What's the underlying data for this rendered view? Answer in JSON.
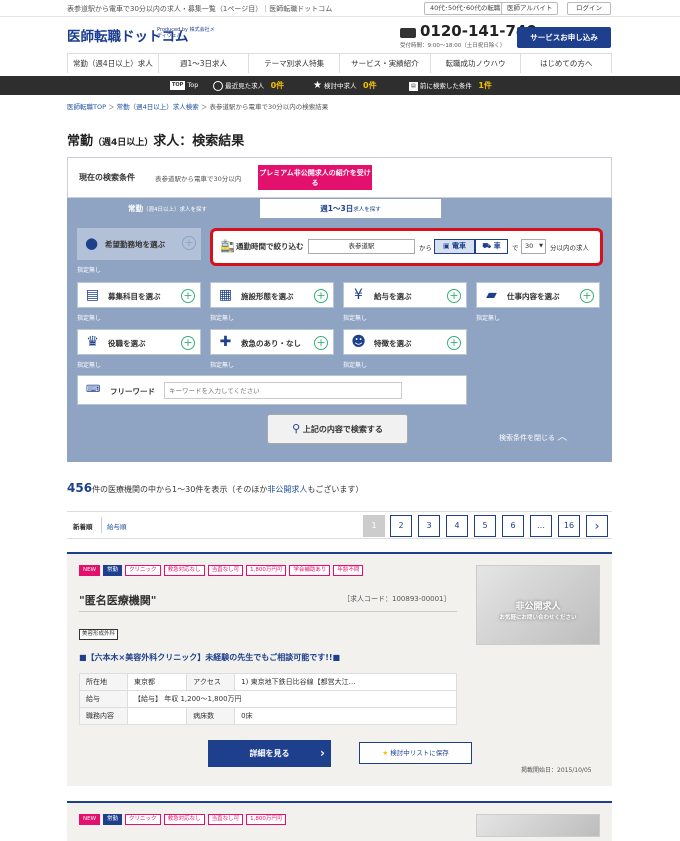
{
  "topbar": {
    "breadcrumb": "表参道駅から電車で30分以内の求人・募集一覧（1ページ目）｜医師転職ドットコム",
    "btn_age": "40代･50代･60代の転職",
    "btn_part": "医師アルバイト",
    "btn_login": "ログイン"
  },
  "header": {
    "logo": "医師転職ドットコム",
    "logo_sub": "Produced by 株式会社メディウェル",
    "phone": "0120-141-740",
    "hours": "受付時間：9:00～18:00（土日祝日除く）",
    "apply": "サービスお申し込み"
  },
  "nav": [
    "常勤（週4日以上）求人",
    "週1～3日求人",
    "テーマ別求人特集",
    "サービス・実績紹介",
    "転職成功ノウハウ",
    "はじめての方へ"
  ],
  "history": {
    "top": "Top",
    "recent_label": "最近見た求人",
    "recent_count": "0件",
    "watch_label": "検討中求人",
    "watch_count": "0件",
    "prev_label": "前に検索した条件",
    "prev_count": "1件"
  },
  "breadcrumb": {
    "home": "医師転職TOP",
    "sep1": "＞",
    "list": "常勤（週4日以上）求人検索",
    "sep2": "＞",
    "current": "表参道駅から電車で30分以内の検索結果"
  },
  "page_title": "常勤",
  "page_title_sub": "（週4日以上）",
  "page_title_rest": "求人：検索結果",
  "conditions": {
    "label": "現在の検索条件",
    "value": "表参道駅から電車で30分以内",
    "premium": "プレミアム非公開求人の紹介を受ける",
    "tab_full": "常勤",
    "tab_full_sub": "（週4日以上）",
    "tab_full_tail": "求人を探す",
    "tab_part": "週1～3日",
    "tab_part_tail": "求人を探す"
  },
  "filters": {
    "area": "希望勤務地を選ぶ",
    "commute_label": "通勤時間で絞り込む",
    "station": "表参道駅",
    "kara": "から",
    "train": "電車",
    "car": "車",
    "de": "で",
    "minutes": "30",
    "minutes_tail": "分以内の求人",
    "specialty": "募集科目を選ぶ",
    "facility": "施設形態を選ぶ",
    "salary": "給与を選ぶ",
    "work": "仕事内容を選ぶ",
    "position": "役職を選ぶ",
    "emergency": "救急のあり・なし",
    "features": "特徴を選ぶ",
    "unspecified": "指定無し",
    "freeword_label": "フリーワード",
    "freeword_placeholder": "キーワードを入力してください",
    "search_button": "上記の内容で検索する",
    "close": "検索条件を閉じる"
  },
  "results": {
    "count": "456",
    "count_text": "件の医療機関の中から1～30件を表示",
    "note_pre": "（そのほか",
    "note_link": "非公開求人",
    "note_post": "もございます）",
    "sort_new": "新着順",
    "sort_salary": "給与順",
    "pages": [
      "1",
      "2",
      "3",
      "4",
      "5",
      "6",
      "…",
      "16"
    ]
  },
  "job": {
    "tags": [
      "NEW",
      "常勤",
      "クリニック",
      "救急対応なし",
      "当直なし可",
      "1,800万円可",
      "学会補助あり",
      "年齢不問"
    ],
    "name": "\"匿名医療機関\"",
    "code": "［求人コード：100893-00001］",
    "dept": "美容形成外科",
    "headline": "■【六本木×美容外科クリニック】未経験の先生でもご相談可能です!!■",
    "location_label": "所在地",
    "location": "東京都",
    "access_label": "アクセス",
    "access": "1) 東京地下鉄日比谷線【都営大江…",
    "salary_label": "給与",
    "salary": "【給与】 年収 1,200～1,800万円",
    "role_label": "職務内容",
    "role": "",
    "beds_label": "病床数",
    "beds": "0床",
    "detail": "詳細を見る",
    "save": "検討中リストに保存",
    "posted": "掲載開始日：2015/10/05",
    "photo_title": "非公開求人",
    "photo_sub": "お気軽にお問い合わせください"
  },
  "job2": {
    "tags": [
      "NEW",
      "常勤",
      "クリニック",
      "救急対応なし",
      "当直なし可",
      "1,800万円可"
    ]
  }
}
